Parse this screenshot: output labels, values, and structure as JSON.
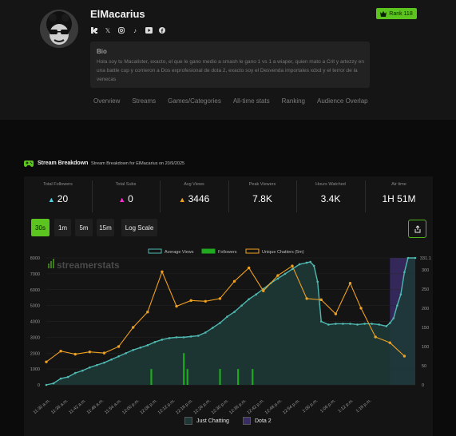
{
  "profile": {
    "name": "ElMacarius",
    "rank": "Rank 118",
    "socials": [
      "kick-icon",
      "x-icon",
      "instagram-icon",
      "tiktok-icon",
      "youtube-icon",
      "facebook-icon"
    ],
    "bio_title": "Bio",
    "bio_text": "Hola soy tu Macalister, exacto, el que le gano medio a smash le gano 1 vs 1 a wiaper, quien mato a Crit y artezzy en una battle cup y corrieron a Dos exprofesional de dota 2, exacto soy el Desvenda importales xdxd y el terror de la venecas"
  },
  "tabs": [
    "Overview",
    "Streams",
    "Games/Categories",
    "All-time stats",
    "Ranking",
    "Audience Overlap"
  ],
  "breakdown": {
    "title": "Stream Breakdown",
    "subtitle": "Stream Breakdown for ElMacarius on 20/9/2025"
  },
  "stats": [
    {
      "label": "Total Followers",
      "value": "20",
      "icon": "triangle-up-icon",
      "color": "#4fd1e0"
    },
    {
      "label": "Total Subs",
      "value": "0",
      "icon": "triangle-up-icon",
      "color": "#ff2bd6"
    },
    {
      "label": "Avg Views",
      "value": "3446",
      "icon": "triangle-up-icon",
      "color": "#f0a020"
    },
    {
      "label": "Peak Viewers",
      "value": "7.8K",
      "icon": "",
      "color": ""
    },
    {
      "label": "Hours Watched",
      "value": "3.4K",
      "icon": "",
      "color": ""
    },
    {
      "label": "Air time",
      "value": "1H 51M",
      "icon": "",
      "color": ""
    }
  ],
  "intervals": [
    "30s",
    "1m",
    "5m",
    "15m"
  ],
  "log_scale": "Log Scale",
  "active_interval": "30s",
  "watermark": "streamerstats",
  "colors": {
    "accent": "#5cc41f",
    "views": "#4fb8b0",
    "followers": "#1faa1f",
    "chatters": "#f0a020",
    "dota": "#3a2c66"
  },
  "chart_data": {
    "type": "line",
    "legend": [
      "Average Views",
      "Followers",
      "Unique Chatters (5m)"
    ],
    "categories_legend": [
      "Just Chatting",
      "Dota 2"
    ],
    "x_ticks": [
      "11:30 a.m.",
      "11:36 a.m.",
      "11:42 a.m.",
      "11:48 a.m.",
      "11:54 a.m.",
      "12:00 p.m.",
      "12:06 p.m.",
      "12:12 p.m.",
      "12:18 p.m.",
      "12:24 p.m.",
      "12:30 p.m.",
      "12:36 p.m.",
      "12:42 p.m.",
      "12:48 p.m.",
      "12:54 p.m.",
      "1:00 p.m.",
      "1:06 p.m.",
      "1:12 p.m.",
      "1:18 p.m."
    ],
    "y_left": {
      "ticks": [
        0,
        1000,
        2000,
        3000,
        4000,
        5000,
        6000,
        7000,
        8000
      ],
      "range": [
        0,
        8000
      ]
    },
    "y_right": {
      "ticks": [
        0,
        50,
        100,
        150,
        200,
        250,
        300
      ],
      "range": [
        0,
        331
      ],
      "max_label": "331.1"
    },
    "views": [
      [
        0,
        0
      ],
      [
        2,
        100
      ],
      [
        4,
        400
      ],
      [
        6,
        500
      ],
      [
        8,
        750
      ],
      [
        10,
        900
      ],
      [
        12,
        1100
      ],
      [
        14,
        1250
      ],
      [
        16,
        1400
      ],
      [
        18,
        1600
      ],
      [
        20,
        1800
      ],
      [
        22,
        2000
      ],
      [
        24,
        2200
      ],
      [
        26,
        2350
      ],
      [
        28,
        2500
      ],
      [
        30,
        2700
      ],
      [
        32,
        2850
      ],
      [
        34,
        2950
      ],
      [
        36,
        3000
      ],
      [
        38,
        3000
      ],
      [
        40,
        3050
      ],
      [
        42,
        3100
      ],
      [
        44,
        3300
      ],
      [
        46,
        3600
      ],
      [
        48,
        3900
      ],
      [
        50,
        4300
      ],
      [
        52,
        4600
      ],
      [
        54,
        5000
      ],
      [
        56,
        5400
      ],
      [
        58,
        5700
      ],
      [
        60,
        6050
      ],
      [
        62,
        6400
      ],
      [
        64,
        6700
      ],
      [
        66,
        7000
      ],
      [
        68,
        7300
      ],
      [
        70,
        7600
      ],
      [
        72,
        7700
      ],
      [
        73,
        7750
      ],
      [
        74,
        7500
      ],
      [
        75,
        6500
      ],
      [
        76,
        4000
      ],
      [
        78,
        3800
      ],
      [
        80,
        3850
      ],
      [
        82,
        3850
      ],
      [
        84,
        3850
      ],
      [
        86,
        3800
      ],
      [
        88,
        3850
      ],
      [
        90,
        3850
      ],
      [
        92,
        3800
      ],
      [
        94,
        3700
      ],
      [
        95,
        3900
      ],
      [
        96,
        4200
      ],
      [
        97,
        5000
      ],
      [
        98,
        5700
      ],
      [
        99,
        7100
      ],
      [
        100,
        8000
      ],
      [
        102,
        8000
      ]
    ],
    "chatters": [
      [
        0,
        60
      ],
      [
        4,
        88
      ],
      [
        8,
        80
      ],
      [
        12,
        86
      ],
      [
        16,
        83
      ],
      [
        20,
        100
      ],
      [
        24,
        150
      ],
      [
        28,
        190
      ],
      [
        32,
        295
      ],
      [
        36,
        205
      ],
      [
        40,
        220
      ],
      [
        44,
        218
      ],
      [
        48,
        225
      ],
      [
        52,
        270
      ],
      [
        56,
        305
      ],
      [
        60,
        245
      ],
      [
        64,
        285
      ],
      [
        68,
        310
      ],
      [
        72,
        225
      ],
      [
        76,
        222
      ],
      [
        80,
        185
      ],
      [
        84,
        265
      ],
      [
        87,
        200
      ],
      [
        91,
        125
      ],
      [
        95,
        110
      ],
      [
        99,
        75
      ]
    ],
    "followers": [
      [
        29,
        1
      ],
      [
        38,
        2
      ],
      [
        39,
        1
      ],
      [
        48,
        1
      ],
      [
        53,
        1
      ],
      [
        57,
        1
      ]
    ],
    "dota_start": 95,
    "x_max": 102
  }
}
